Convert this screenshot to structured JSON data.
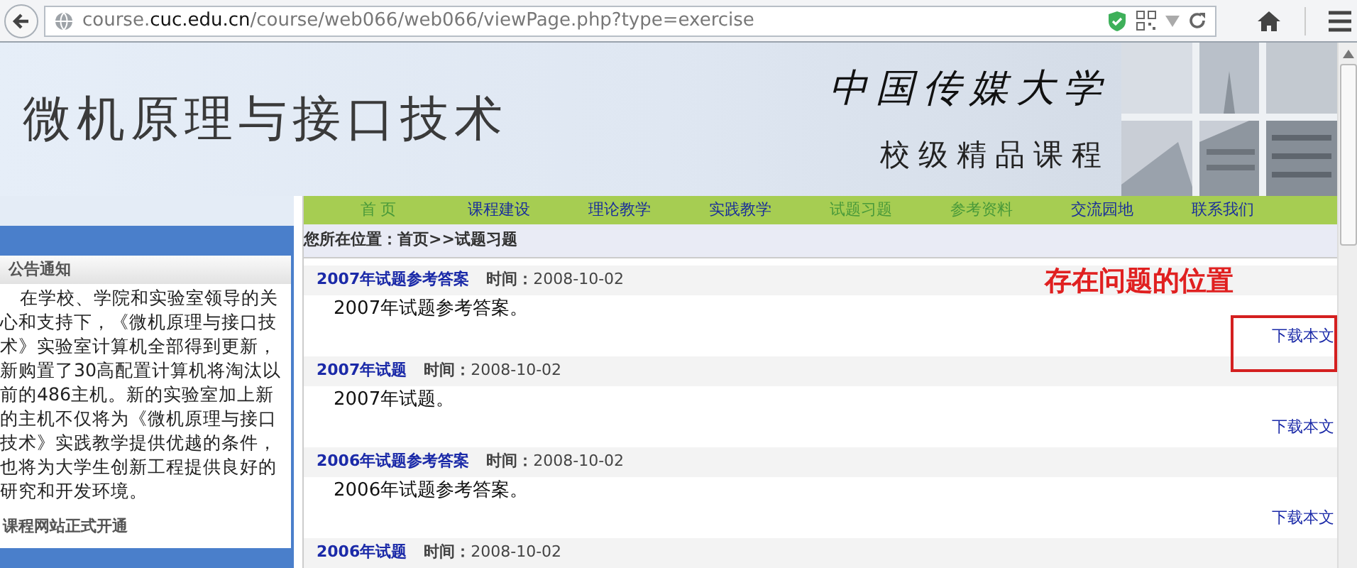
{
  "browser": {
    "url": "course.**cuc.edu.cn**/course/web066/web066/viewPage.php?type=exercise"
  },
  "header": {
    "title": "微机原理与接口技术",
    "school": "中国传媒大学",
    "subtitle": "校级精品课程"
  },
  "nav": [
    {
      "label": "首 页",
      "visited": true
    },
    {
      "label": "课程建设",
      "visited": false
    },
    {
      "label": "理论教学",
      "visited": false
    },
    {
      "label": "实践教学",
      "visited": false
    },
    {
      "label": "试题习题",
      "visited": true
    },
    {
      "label": "参考资料",
      "visited": true
    },
    {
      "label": "交流园地",
      "visited": false
    },
    {
      "label": "联系我们",
      "visited": false
    }
  ],
  "sidebar": {
    "heading": "公告通知",
    "body": "在学校、学院和实验室领导的关心和支持下，《微机原理与接口技术》实验室计算机全部得到更新，新购置了30高配置计算机将淘汰以前的486主机。新的实验室加上新的主机不仅将为《微机原理与接口技术》实践教学提供优越的条件，也将为大学生创新工程提供良好的研究和开发环境。",
    "next_heading": "课程网站正式开通"
  },
  "breadcrumb": "您所在位置：首页>>试题习题",
  "entries": [
    {
      "title": "2007年试题参考答案",
      "time_label": "时间：",
      "date": "2008-10-02",
      "summary": "2007年试题参考答案。",
      "download": "下载本文"
    },
    {
      "title": "2007年试题",
      "time_label": "时间：",
      "date": "2008-10-02",
      "summary": "2007年试题。",
      "download": "下载本文"
    },
    {
      "title": "2006年试题参考答案",
      "time_label": "时间：",
      "date": "2008-10-02",
      "summary": "2006年试题参考答案。",
      "download": "下载本文"
    },
    {
      "title": "2006年试题",
      "time_label": "时间：",
      "date": "2008-10-02"
    }
  ],
  "annotation": {
    "text": "存在问题的位置"
  }
}
